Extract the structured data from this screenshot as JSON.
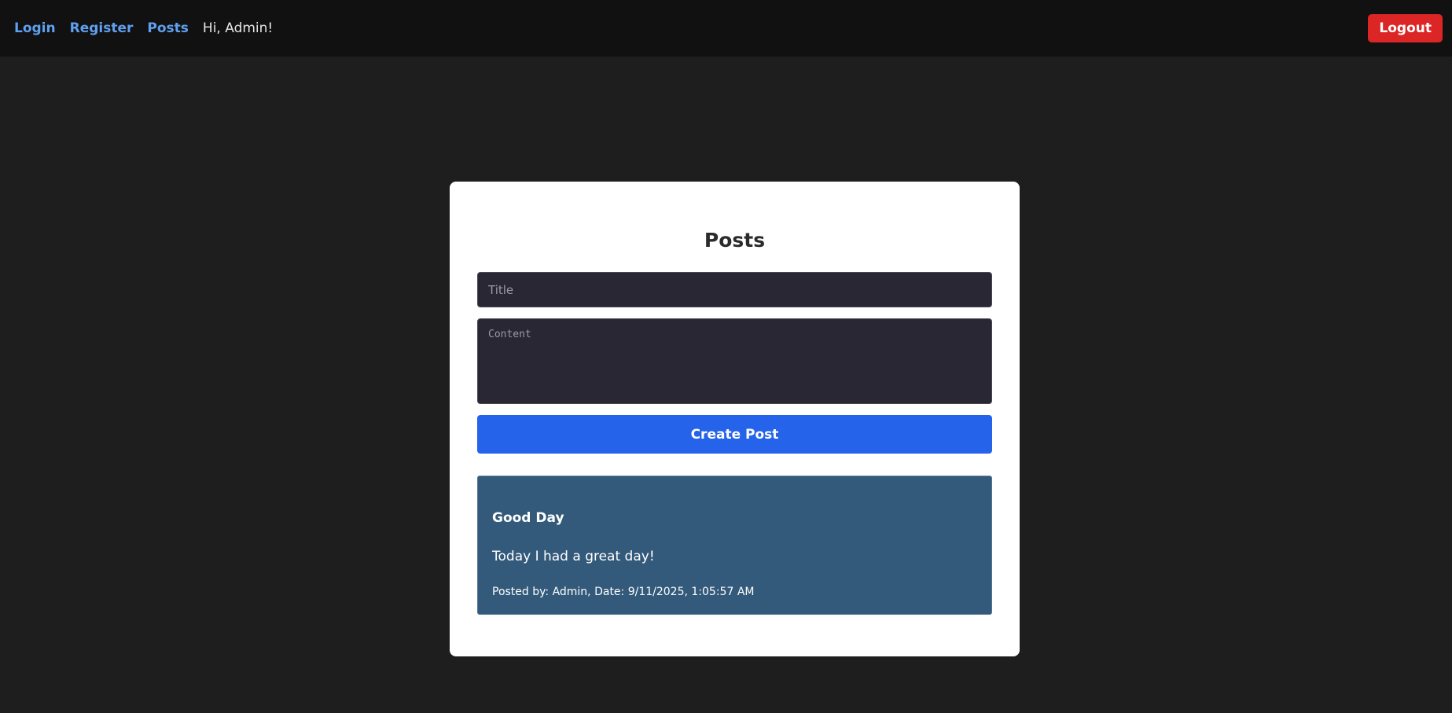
{
  "nav": {
    "login_label": "Login",
    "register_label": "Register",
    "posts_label": "Posts",
    "greeting": "Hi, Admin!",
    "logout_label": "Logout"
  },
  "posts_page": {
    "heading": "Posts",
    "title_placeholder": "Title",
    "title_value": "",
    "content_placeholder": "Content",
    "content_value": "",
    "create_button_label": "Create Post"
  },
  "posts": [
    {
      "title": "Good Day",
      "content": "Today I had a great day!",
      "meta": "Posted by: Admin, Date: 9/11/2025, 1:05:57 AM"
    }
  ],
  "colors": {
    "page_background": "#1e1e1e",
    "navbar_background": "#111112",
    "nav_link": "#5fa0ef",
    "logout_button": "#dc2626",
    "create_button": "#2563eb",
    "post_background": "#335a7a",
    "input_background": "#282733",
    "card_background": "#ffffff"
  }
}
